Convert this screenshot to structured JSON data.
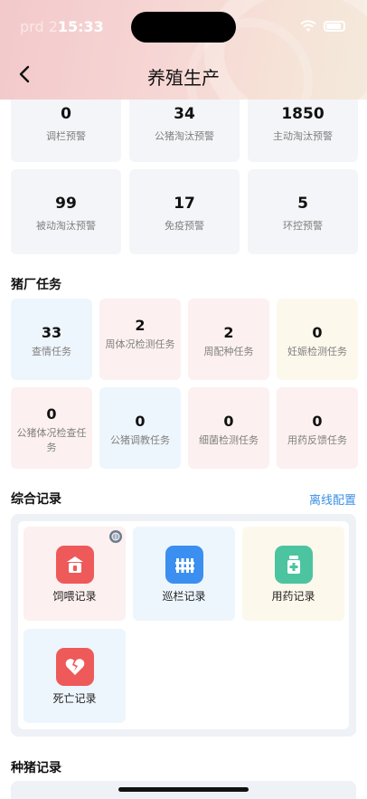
{
  "status_bar": {
    "carrier": "prd 2",
    "time": "15:33"
  },
  "header": {
    "title": "养殖生产"
  },
  "warnings_row1": [
    {
      "value": "0",
      "label": "调栏预警"
    },
    {
      "value": "34",
      "label": "公猪淘汰预警"
    },
    {
      "value": "1850",
      "label": "主动淘汰预警"
    }
  ],
  "warnings_row2": [
    {
      "value": "99",
      "label": "被动淘汰预警"
    },
    {
      "value": "17",
      "label": "免疫预警"
    },
    {
      "value": "5",
      "label": "环控预警"
    }
  ],
  "farm_tasks": {
    "title": "猪厂任务",
    "items": [
      {
        "value": "33",
        "label": "查情任务",
        "color": "#eef6fd"
      },
      {
        "value": "2",
        "label": "周体况检测任务",
        "color": "#fdf0f0"
      },
      {
        "value": "2",
        "label": "周配种任务",
        "color": "#fdf0f0"
      },
      {
        "value": "0",
        "label": "妊娠检测任务",
        "color": "#fdf8ec"
      },
      {
        "value": "0",
        "label": "公猪体况检查任务",
        "color": "#fdf0f0"
      },
      {
        "value": "0",
        "label": "公猪调教任务",
        "color": "#eef6fd"
      },
      {
        "value": "0",
        "label": "细菌检测任务",
        "color": "#fdf0f0"
      },
      {
        "value": "0",
        "label": "用药反馈任务",
        "color": "#fdf0f0"
      }
    ]
  },
  "records": {
    "title": "综合记录",
    "link": "离线配置",
    "items": [
      {
        "label": "饲喂记录",
        "icon": "feed-icon",
        "icon_color": "#ee5a5a",
        "bg": "#fdf0f0"
      },
      {
        "label": "巡栏记录",
        "icon": "fence-icon",
        "icon_color": "#3b8ff0",
        "bg": "#eef6fd"
      },
      {
        "label": "用药记录",
        "icon": "medicine-icon",
        "icon_color": "#4cc4a0",
        "bg": "#fdf8ec"
      },
      {
        "label": "死亡记录",
        "icon": "broken-heart-icon",
        "icon_color": "#ee5a5a",
        "bg": "#eef6fd"
      }
    ]
  },
  "breeding_records": {
    "title": "种猪记录"
  }
}
